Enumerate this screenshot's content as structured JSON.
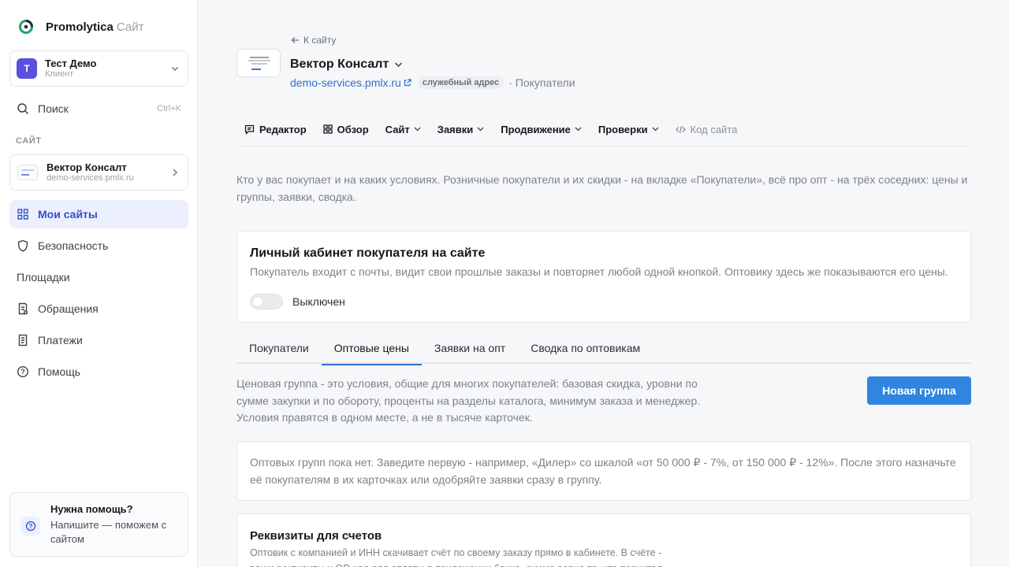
{
  "brand": {
    "name": "Promolytica",
    "suffix": "Сайт"
  },
  "account": {
    "initial": "Т",
    "name": "Тест Демо",
    "role": "Клиент"
  },
  "sidebar": {
    "search": {
      "label": "Поиск",
      "shortcut": "Ctrl+K"
    },
    "section_label": "САЙТ",
    "site_card": {
      "name": "Вектор Консалт",
      "url": "demo-services.pmlx.ru"
    },
    "items": [
      {
        "label": "Мои сайты",
        "icon": "grid-icon",
        "active": true
      },
      {
        "label": "Безопасность",
        "icon": "shield-icon"
      },
      {
        "label": "Площадки",
        "icon": ""
      },
      {
        "label": "Обращения",
        "icon": "inbox-icon"
      },
      {
        "label": "Платежи",
        "icon": "receipt-icon"
      },
      {
        "label": "Помощь",
        "icon": "question-circle-icon"
      }
    ],
    "help": {
      "title": "Нужна помощь?",
      "text": "Напишите — поможем с сайтом"
    }
  },
  "header": {
    "back": "К сайту",
    "title": "Вектор Консалт",
    "url": "demo-services.pmlx.ru",
    "badge": "служебный адрес",
    "section": "· Покупатели"
  },
  "top_menu": [
    {
      "label": "Редактор",
      "icon": "comment-icon"
    },
    {
      "label": "Обзор",
      "icon": "grid-icon"
    },
    {
      "label": "Сайт",
      "dropdown": true
    },
    {
      "label": "Заявки",
      "dropdown": true
    },
    {
      "label": "Продвижение",
      "dropdown": true
    },
    {
      "label": "Проверки",
      "dropdown": true
    },
    {
      "label": "Код сайта",
      "icon": "code-icon",
      "muted": true
    }
  ],
  "intro": "Кто у вас покупает и на каких условиях. Розничные покупатели и их скидки - на вкладке «Покупатели», всё про опт - на трёх соседних: цены и группы, заявки, сводка.",
  "cabinet": {
    "title": "Личный кабинет покупателя на сайте",
    "desc": "Покупатель входит с почты, видит свои прошлые заказы и повторяет любой одной кнопкой. Оптовику здесь же показываются его цены.",
    "toggle_label": "Выключен",
    "enabled": false
  },
  "tabs": [
    {
      "label": "Покупатели",
      "active": false
    },
    {
      "label": "Оптовые цены",
      "active": true
    },
    {
      "label": "Заявки на опт",
      "active": false
    },
    {
      "label": "Сводка по оптовикам",
      "active": false
    }
  ],
  "groups": {
    "desc": "Ценовая группа - это условия, общие для многих покупателей: базовая скидка, уровни по сумме закупки и по обороту, проценты на разделы каталога, минимум заказа и менеджер. Условия правятся в одном месте, а не в тысяче карточек.",
    "new_button": "Новая группа",
    "empty": "Оптовых групп пока нет. Заведите первую - например, «Дилер» со шкалой «от 50 000 ₽ - 7%, от 150 000 ₽ - 12%». После этого назначьте её покупателям в их карточках или одобряйте заявки сразу в группу."
  },
  "requisites": {
    "title": "Реквизиты для счетов",
    "desc": "Оптовик с компанией и ИНН скачивает счёт по своему заказу прямо в кабинете. В счёте - ваши реквизиты и QR-код для оплаты в приложении банка, сумма ровно та, что посчитал"
  },
  "colors": {
    "accent": "#2f86e0",
    "active_nav_bg": "#eceffd",
    "active_nav_text": "#3150c8",
    "avatar": "#5b4fe0",
    "link": "#2e6fd1"
  }
}
